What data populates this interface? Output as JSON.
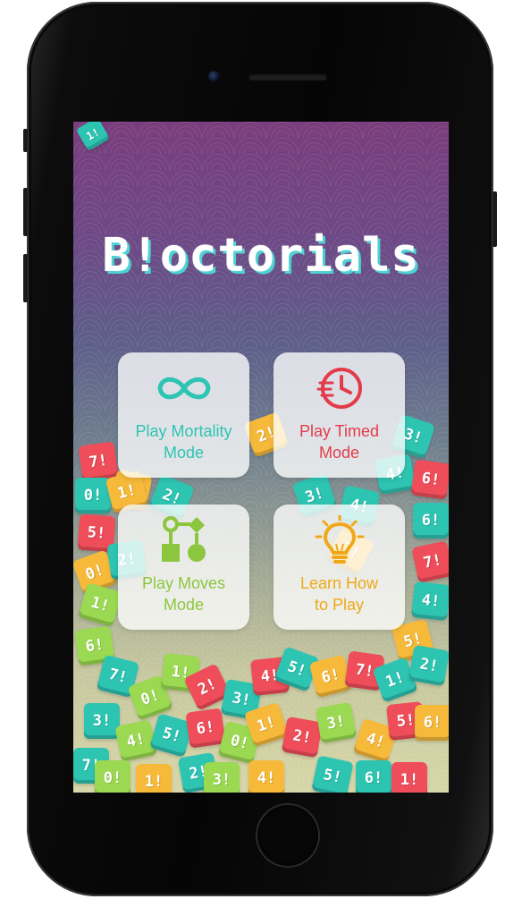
{
  "app": {
    "title": "B!octorials"
  },
  "menu": {
    "mortality": {
      "label": "Play Mortality\nMode",
      "icon": "infinity-icon",
      "color": "#2ec4b2"
    },
    "timed": {
      "label": "Play Timed\nMode",
      "icon": "clock-icon",
      "color": "#e23c4a"
    },
    "moves": {
      "label": "Play Moves\nMode",
      "icon": "flowchart-icon",
      "color": "#8cc63f"
    },
    "learn": {
      "label": "Learn How\nto Play",
      "icon": "lightbulb-icon",
      "color": "#f0a818"
    }
  },
  "tiles": [
    "1!",
    "7!",
    "5!",
    "2!",
    "3!",
    "4!",
    "6!",
    "0!",
    "1!",
    "2!",
    "3!",
    "4!",
    "5!",
    "6!",
    "7!",
    "0!",
    "1!",
    "2!",
    "3!",
    "4!",
    "5!",
    "6!",
    "7!",
    "0!",
    "1!",
    "2!",
    "3!",
    "4!",
    "5!",
    "6!",
    "7!",
    "1!",
    "2!",
    "3!",
    "4!",
    "5!",
    "6!",
    "0!",
    "1!",
    "2!",
    "3!",
    "4!",
    "5!",
    "6!",
    "7!",
    "0!",
    "1!",
    "2!",
    "3!",
    "4!",
    "5!",
    "6!"
  ],
  "colors": {
    "teal": "#2ec4b2",
    "red": "#ef4d5a",
    "yellow": "#f6b93a",
    "lime": "#9ad951"
  }
}
